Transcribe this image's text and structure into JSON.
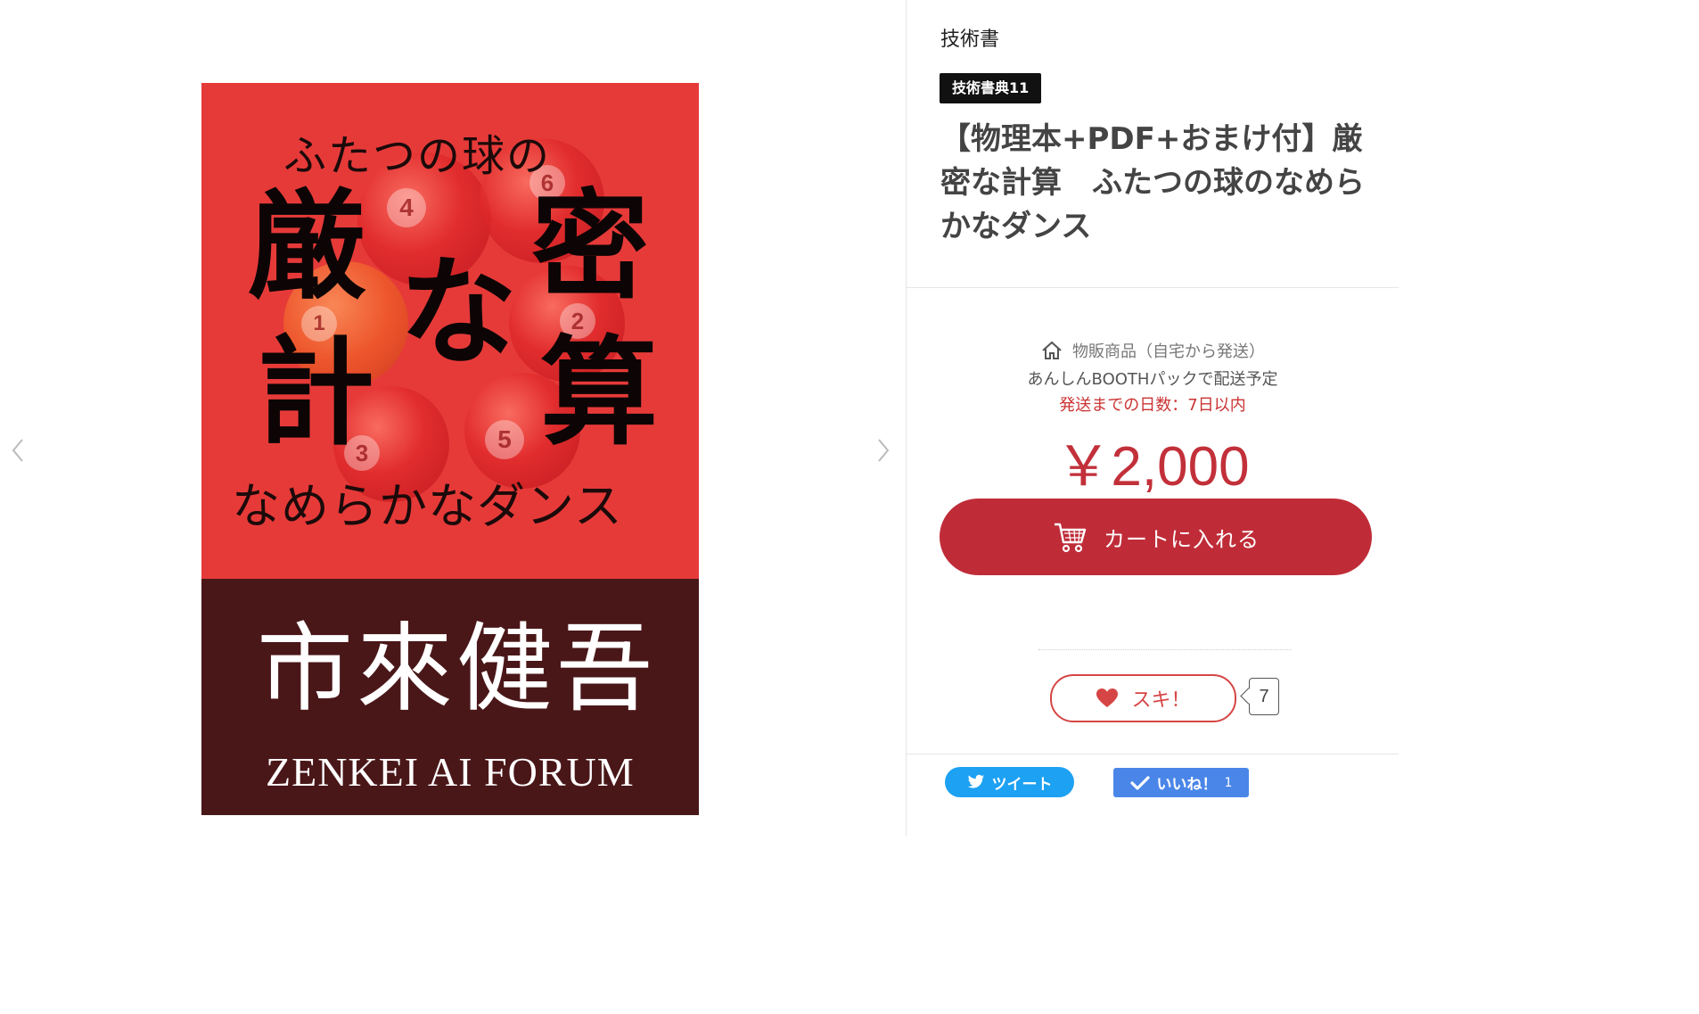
{
  "category": "技術書",
  "event_tag": "技術書典11",
  "product_title": "【物理本+PDF+おまけ付】厳密な計算　ふたつの球のなめらかなダンス",
  "cover": {
    "subtitle_top": "ふたつの球の",
    "kanji_1": "厳",
    "kanji_2": "計",
    "kanji_3": "な",
    "kanji_4": "密",
    "kanji_5": "算",
    "subtitle_bottom": "なめらかなダンス",
    "author": "市來健吾",
    "organization": "ZENKEI AI FORUM",
    "ball_numbers": [
      "4",
      "6",
      "1",
      "2",
      "3",
      "5"
    ]
  },
  "shipping": {
    "type": "物販商品（自宅から発送）",
    "pack": "あんしんBOOTHパックで配送予定",
    "days": "発送までの日数：7日以内"
  },
  "price": "￥2,000",
  "cart_button": "カートに入れる",
  "like": {
    "label": "スキ！",
    "count": "7"
  },
  "social": {
    "tweet": "ツイート",
    "fb_like": "いいね！",
    "fb_count": "1"
  },
  "icons": {
    "prev": "chevron-left-icon",
    "next": "chevron-right-icon",
    "home": "home-icon",
    "cart": "cart-icon",
    "heart": "heart-icon",
    "twitter": "twitter-bird-icon",
    "facebook": "check-icon"
  },
  "colors": {
    "accent": "#bf2c38",
    "price": "#c2303a",
    "shipping_days": "#cc3333",
    "cover_red": "#e63a39",
    "cover_dark": "#4a1719",
    "twitter": "#1da1f2",
    "facebook": "#4a86e8"
  }
}
